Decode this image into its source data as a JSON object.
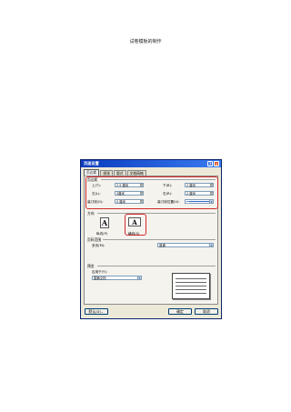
{
  "document": {
    "title": "试卷模板的制作"
  },
  "dialog": {
    "title": "页面设置",
    "help_glyph": "?",
    "close_glyph": "✕",
    "tabs": [
      {
        "label": "页边距",
        "active": true
      },
      {
        "label": "纸张",
        "active": false
      },
      {
        "label": "版式",
        "active": false
      },
      {
        "label": "文档网格",
        "active": false
      }
    ],
    "margins": {
      "section_label": "页边距",
      "top_label": "上(T):",
      "top_value": "2.5 厘米",
      "bottom_label": "下(B):",
      "bottom_value": "2 厘米",
      "left_label": "左(L):",
      "left_value": "3厘米",
      "right_label": "右(R):",
      "right_value": "2 厘米",
      "gutter_label": "装订线(G):",
      "gutter_value": "0 厘米",
      "gutter_pos_label": "装订线位置(U):",
      "gutter_pos_value": "左"
    },
    "orientation": {
      "section_label": "方向",
      "portrait_label": "纵向(P)",
      "landscape_label": "横向(S)",
      "icon_letter": "A",
      "selected": "landscape"
    },
    "pages": {
      "section_label": "页码范围",
      "multiple_label": "多页(M):",
      "multiple_value": "普通"
    },
    "preview": {
      "section_label": "预览",
      "apply_label": "应用于(Y):",
      "apply_value": "整篇文档"
    },
    "buttons": {
      "default": "默认(D)...",
      "ok": "确定",
      "cancel": "取消"
    },
    "colors": {
      "titlebar": "#0a3cbe",
      "highlight": "#d42a2a",
      "face": "#ece9d8"
    }
  }
}
